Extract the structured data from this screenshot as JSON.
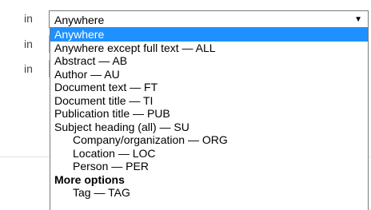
{
  "rows": {
    "in_label": "in"
  },
  "field": {
    "selected_value": "Anywhere",
    "arrow": "▼"
  },
  "options": [
    "Anywhere",
    "Anywhere except full text — ALL",
    "Abstract — AB",
    "Author — AU",
    "Document text — FT",
    "Document title — TI",
    "Publication title — PUB",
    "Subject heading (all) — SU",
    "Company/organization — ORG",
    "Location — LOC",
    "Person — PER"
  ],
  "group": {
    "label": "More options",
    "items": [
      "Tag — TAG"
    ]
  },
  "colors": {
    "highlight": "#1e90ff"
  }
}
